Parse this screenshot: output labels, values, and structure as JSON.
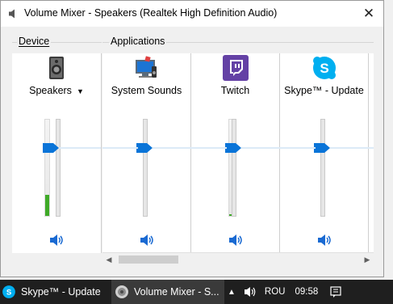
{
  "window": {
    "title": "Volume Mixer - Speakers (Realtek High Definition Audio)",
    "close_glyph": "✕"
  },
  "device_group": {
    "label": "Device",
    "channel": {
      "label": "Speakers",
      "icon": "speaker-device-icon",
      "volume": 0.72,
      "peak": 0.22
    }
  },
  "applications_group": {
    "label": "Applications",
    "channels": [
      {
        "label": "System Sounds",
        "icon": "system-sounds-icon",
        "volume": 0.72,
        "peak": 0.0
      },
      {
        "label": "Twitch",
        "icon": "twitch-icon",
        "volume": 0.72,
        "peak": 0.02
      },
      {
        "label": "Skype™ - Update",
        "icon": "skype-icon",
        "volume": 0.72,
        "peak": 0.0
      }
    ]
  },
  "colors": {
    "thumb": "#0a74d8",
    "meter": "#3faa28",
    "twitch": "#6441a5",
    "skype": "#00aff0"
  },
  "taskbar": {
    "tasks": [
      {
        "label": "Skype™ - Update",
        "icon": "skype-icon"
      },
      {
        "label": "Volume Mixer - S...",
        "icon": "volume-mixer-icon"
      }
    ],
    "tray": {
      "language": "ROU",
      "time": "09:58",
      "date": ""
    }
  }
}
